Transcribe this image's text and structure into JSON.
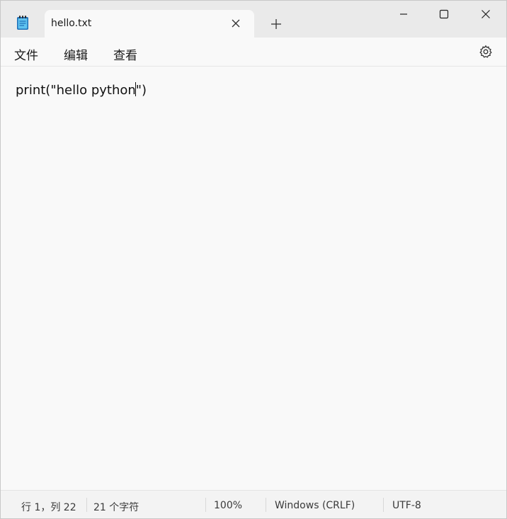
{
  "tab": {
    "title": "hello.txt",
    "close_icon": "close-icon"
  },
  "titlebar": {
    "new_tab_icon": "plus-icon",
    "app_icon": "notepad-icon"
  },
  "menu": {
    "file": "文件",
    "edit": "编辑",
    "view": "查看",
    "settings_icon": "gear-icon"
  },
  "editor": {
    "text_before_caret": "print(\"hello python",
    "text_after_caret": "\")"
  },
  "status": {
    "position": "行 1，列 22",
    "char_count": "21 个字符",
    "zoom": "100%",
    "line_ending": "Windows (CRLF)",
    "encoding": "UTF-8"
  },
  "colors": {
    "window_bg": "#f9f9f9",
    "titlebar_bg": "#eaeaea",
    "statusbar_bg": "#f3f3f3",
    "accent": "#3a8ee6"
  }
}
